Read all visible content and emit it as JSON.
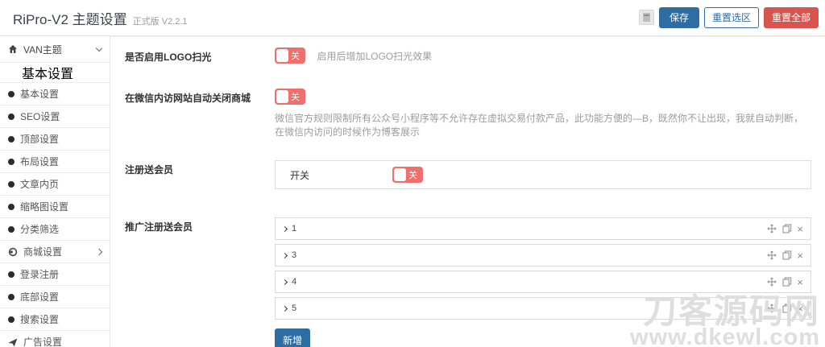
{
  "header": {
    "title": "RiPro-V2 主题设置",
    "version": "正式版 V2.2.1",
    "buttons": {
      "save": "保存",
      "reset_section": "重置选区",
      "reset_all": "重置全部"
    }
  },
  "sidebar": {
    "group_label": "VAN主题",
    "active_item": "基本设置",
    "items": [
      "基本设置",
      "SEO设置",
      "顶部设置",
      "布局设置",
      "文章内页",
      "缩略图设置",
      "分类筛选",
      "商城设置",
      "登录注册",
      "底部设置",
      "搜索设置",
      "广告设置"
    ]
  },
  "main": {
    "rows": [
      {
        "label": "是否启用LOGO扫光",
        "toggle_state": "关",
        "desc": "启用后增加LOGO扫光效果"
      },
      {
        "label": "在微信内访网站自动关闭商城",
        "toggle_state": "关",
        "desc": "微信官方规则限制所有公众号小程序等不允许存在虚拟交易付款产品，此功能方便的—B，既然你不让出现，我就自动判断，在微信内访问的时候作为博客展示"
      },
      {
        "label": "注册送会员",
        "field_label": "开关",
        "toggle_state": "关"
      },
      {
        "label": "推广注册送会员",
        "items": [
          "1",
          "3",
          "4",
          "5"
        ],
        "add_label": "新增"
      }
    ]
  },
  "watermark": {
    "line1": "刀客源码网",
    "line2": "www.dkewl.com"
  },
  "colors": {
    "primary_blue": "#2e6da4",
    "danger_red": "#d9534f",
    "toggle_off_red": "#f06e6b"
  }
}
